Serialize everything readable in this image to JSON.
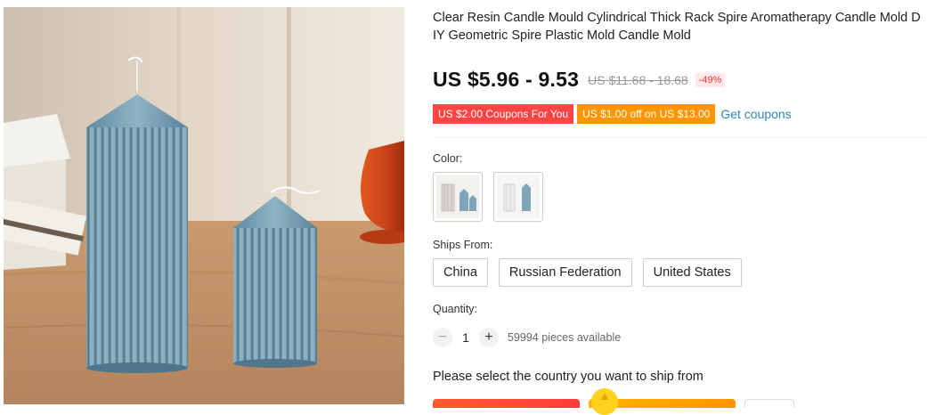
{
  "product": {
    "title": "Clear Resin Candle Mould Cylindrical Thick Rack Spire Aromatherapy Candle Mold DIY Geometric Spire Plastic Mold Candle Mold",
    "price": "US $5.96 - 9.53",
    "original_price": "US $11.68 - 18.68",
    "discount": "-49%",
    "image_icon": "product-photo-candles"
  },
  "coupons": {
    "items": [
      "US $2.00 Coupons For You",
      "US $1.00 off on US $13.00"
    ],
    "get_label": "Get coupons"
  },
  "color": {
    "label": "Color:",
    "options": [
      "candle-mold-thumbnail-1",
      "candle-mold-thumbnail-2"
    ]
  },
  "ships_from": {
    "label": "Ships From:",
    "options": [
      "China",
      "Russian Federation",
      "United States"
    ]
  },
  "quantity": {
    "label": "Quantity:",
    "minus": "−",
    "value": "1",
    "plus": "+",
    "available": "59994 pieces available"
  },
  "ship_note": "Please select the country you want to ship from",
  "colors": {
    "coupon_red": "#ff4444",
    "coupon_orange": "#ff9500",
    "link_blue": "#2e86c1",
    "candle_blue": "#7ea6b8"
  }
}
